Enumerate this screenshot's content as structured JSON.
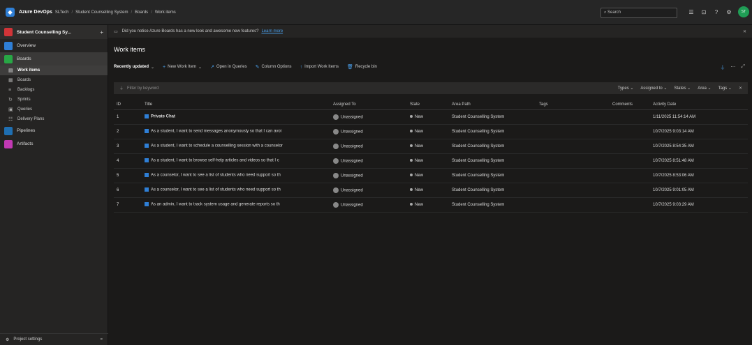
{
  "topbar": {
    "brand": "Azure DevOps",
    "crumbs": [
      "SLTech",
      "Student Counselling System",
      "Boards",
      "Work items"
    ],
    "search_placeholder": "Search",
    "avatar_initials": "ST"
  },
  "sidebar": {
    "project": "Student Counselling Sy...",
    "items": [
      {
        "label": "Overview",
        "color": "#2f7fd6"
      },
      {
        "label": "Boards",
        "color": "#28a745"
      },
      {
        "label": "Work items"
      },
      {
        "label": "Boards"
      },
      {
        "label": "Backlogs"
      },
      {
        "label": "Sprints"
      },
      {
        "label": "Queries"
      },
      {
        "label": "Delivery Plans"
      },
      {
        "label": "Pipelines",
        "color": "#1f6fb2"
      },
      {
        "label": "Artifacts",
        "color": "#c239b3"
      }
    ],
    "footer": "Project settings"
  },
  "banner": {
    "text": "Did you notice Azure Boards has a new look and awesome new features?",
    "link": "Learn more"
  },
  "page": {
    "title": "Work items"
  },
  "toolbar": {
    "view": "Recently updated",
    "new_item": "New Work Item",
    "open_queries": "Open in Queries",
    "column_options": "Column Options",
    "import": "Import Work Items",
    "recycle": "Recycle bin"
  },
  "filter": {
    "placeholder": "Filter by keyword",
    "chips": [
      "Types",
      "Assigned to",
      "States",
      "Area",
      "Tags"
    ]
  },
  "table": {
    "headers": [
      "ID",
      "Title",
      "Assigned To",
      "State",
      "Area Path",
      "Tags",
      "Comments",
      "Activity Date"
    ],
    "rows": [
      {
        "id": "1",
        "title": "Private Chat",
        "assigned": "Unassigned",
        "state": "New",
        "area": "Student Counselling System",
        "date": "1/11/2025 11:54:14 AM"
      },
      {
        "id": "2",
        "title": "As a student, I want to send messages anonymously so that I can avoi",
        "assigned": "Unassigned",
        "state": "New",
        "area": "Student Counselling System",
        "date": "10/7/2025 9:03:14 AM"
      },
      {
        "id": "3",
        "title": "As a student, I want to schedule a counselling session with a counselor",
        "assigned": "Unassigned",
        "state": "New",
        "area": "Student Counselling System",
        "date": "10/7/2025 8:54:35 AM"
      },
      {
        "id": "4",
        "title": "As a student, I want to browse self-help articles and videos so that I c",
        "assigned": "Unassigned",
        "state": "New",
        "area": "Student Counselling System",
        "date": "10/7/2025 8:51:48 AM"
      },
      {
        "id": "5",
        "title": "As a counselor, I want to see a list of students who need support so th",
        "assigned": "Unassigned",
        "state": "New",
        "area": "Student Counselling System",
        "date": "10/7/2025 8:53:06 AM"
      },
      {
        "id": "6",
        "title": "As a counselor, I want to see a list of students who need support so th",
        "assigned": "Unassigned",
        "state": "New",
        "area": "Student Counselling System",
        "date": "10/7/2025 9:01:05 AM"
      },
      {
        "id": "7",
        "title": "As an admin, I want to track system usage and generate reports so th",
        "assigned": "Unassigned",
        "state": "New",
        "area": "Student Counselling System",
        "date": "10/7/2025 9:03:29 AM"
      }
    ]
  },
  "colors": {
    "accent": "#2f7fd6",
    "link": "#4aa0ec",
    "avatar": "#1f9d55"
  }
}
